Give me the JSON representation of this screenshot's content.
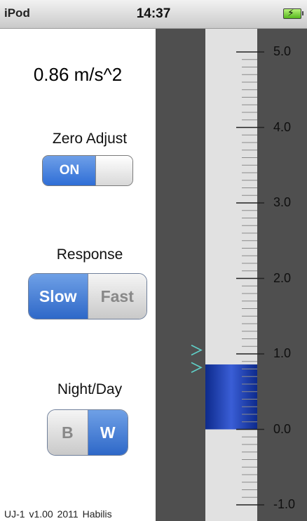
{
  "status_bar": {
    "carrier": "iPod",
    "time": "14:37",
    "battery_icon": "battery-charging-icon"
  },
  "reading": "0.86 m/s^2",
  "zero_adjust": {
    "label": "Zero Adjust",
    "state_label": "ON"
  },
  "response": {
    "label": "Response",
    "options": [
      "Slow",
      "Fast"
    ],
    "selected": "Slow"
  },
  "night_day": {
    "label": "Night/Day",
    "options": [
      "B",
      "W"
    ],
    "selected": "W"
  },
  "footer": "UJ-1 v1.00   2011 Habilis",
  "gauge": {
    "scale_labels": [
      "5.0",
      "4.0",
      "3.0",
      "2.0",
      "1.0",
      "0.0",
      "-1.0"
    ],
    "min": -1.0,
    "max": 5.0,
    "level": 0.86,
    "marker_levels": [
      1.05,
      0.82
    ],
    "colors": {
      "fill": "#1a3aa8",
      "tube": "#e1e1e1",
      "background": "#4f4f4f",
      "marker": "#5fd0c8"
    }
  }
}
